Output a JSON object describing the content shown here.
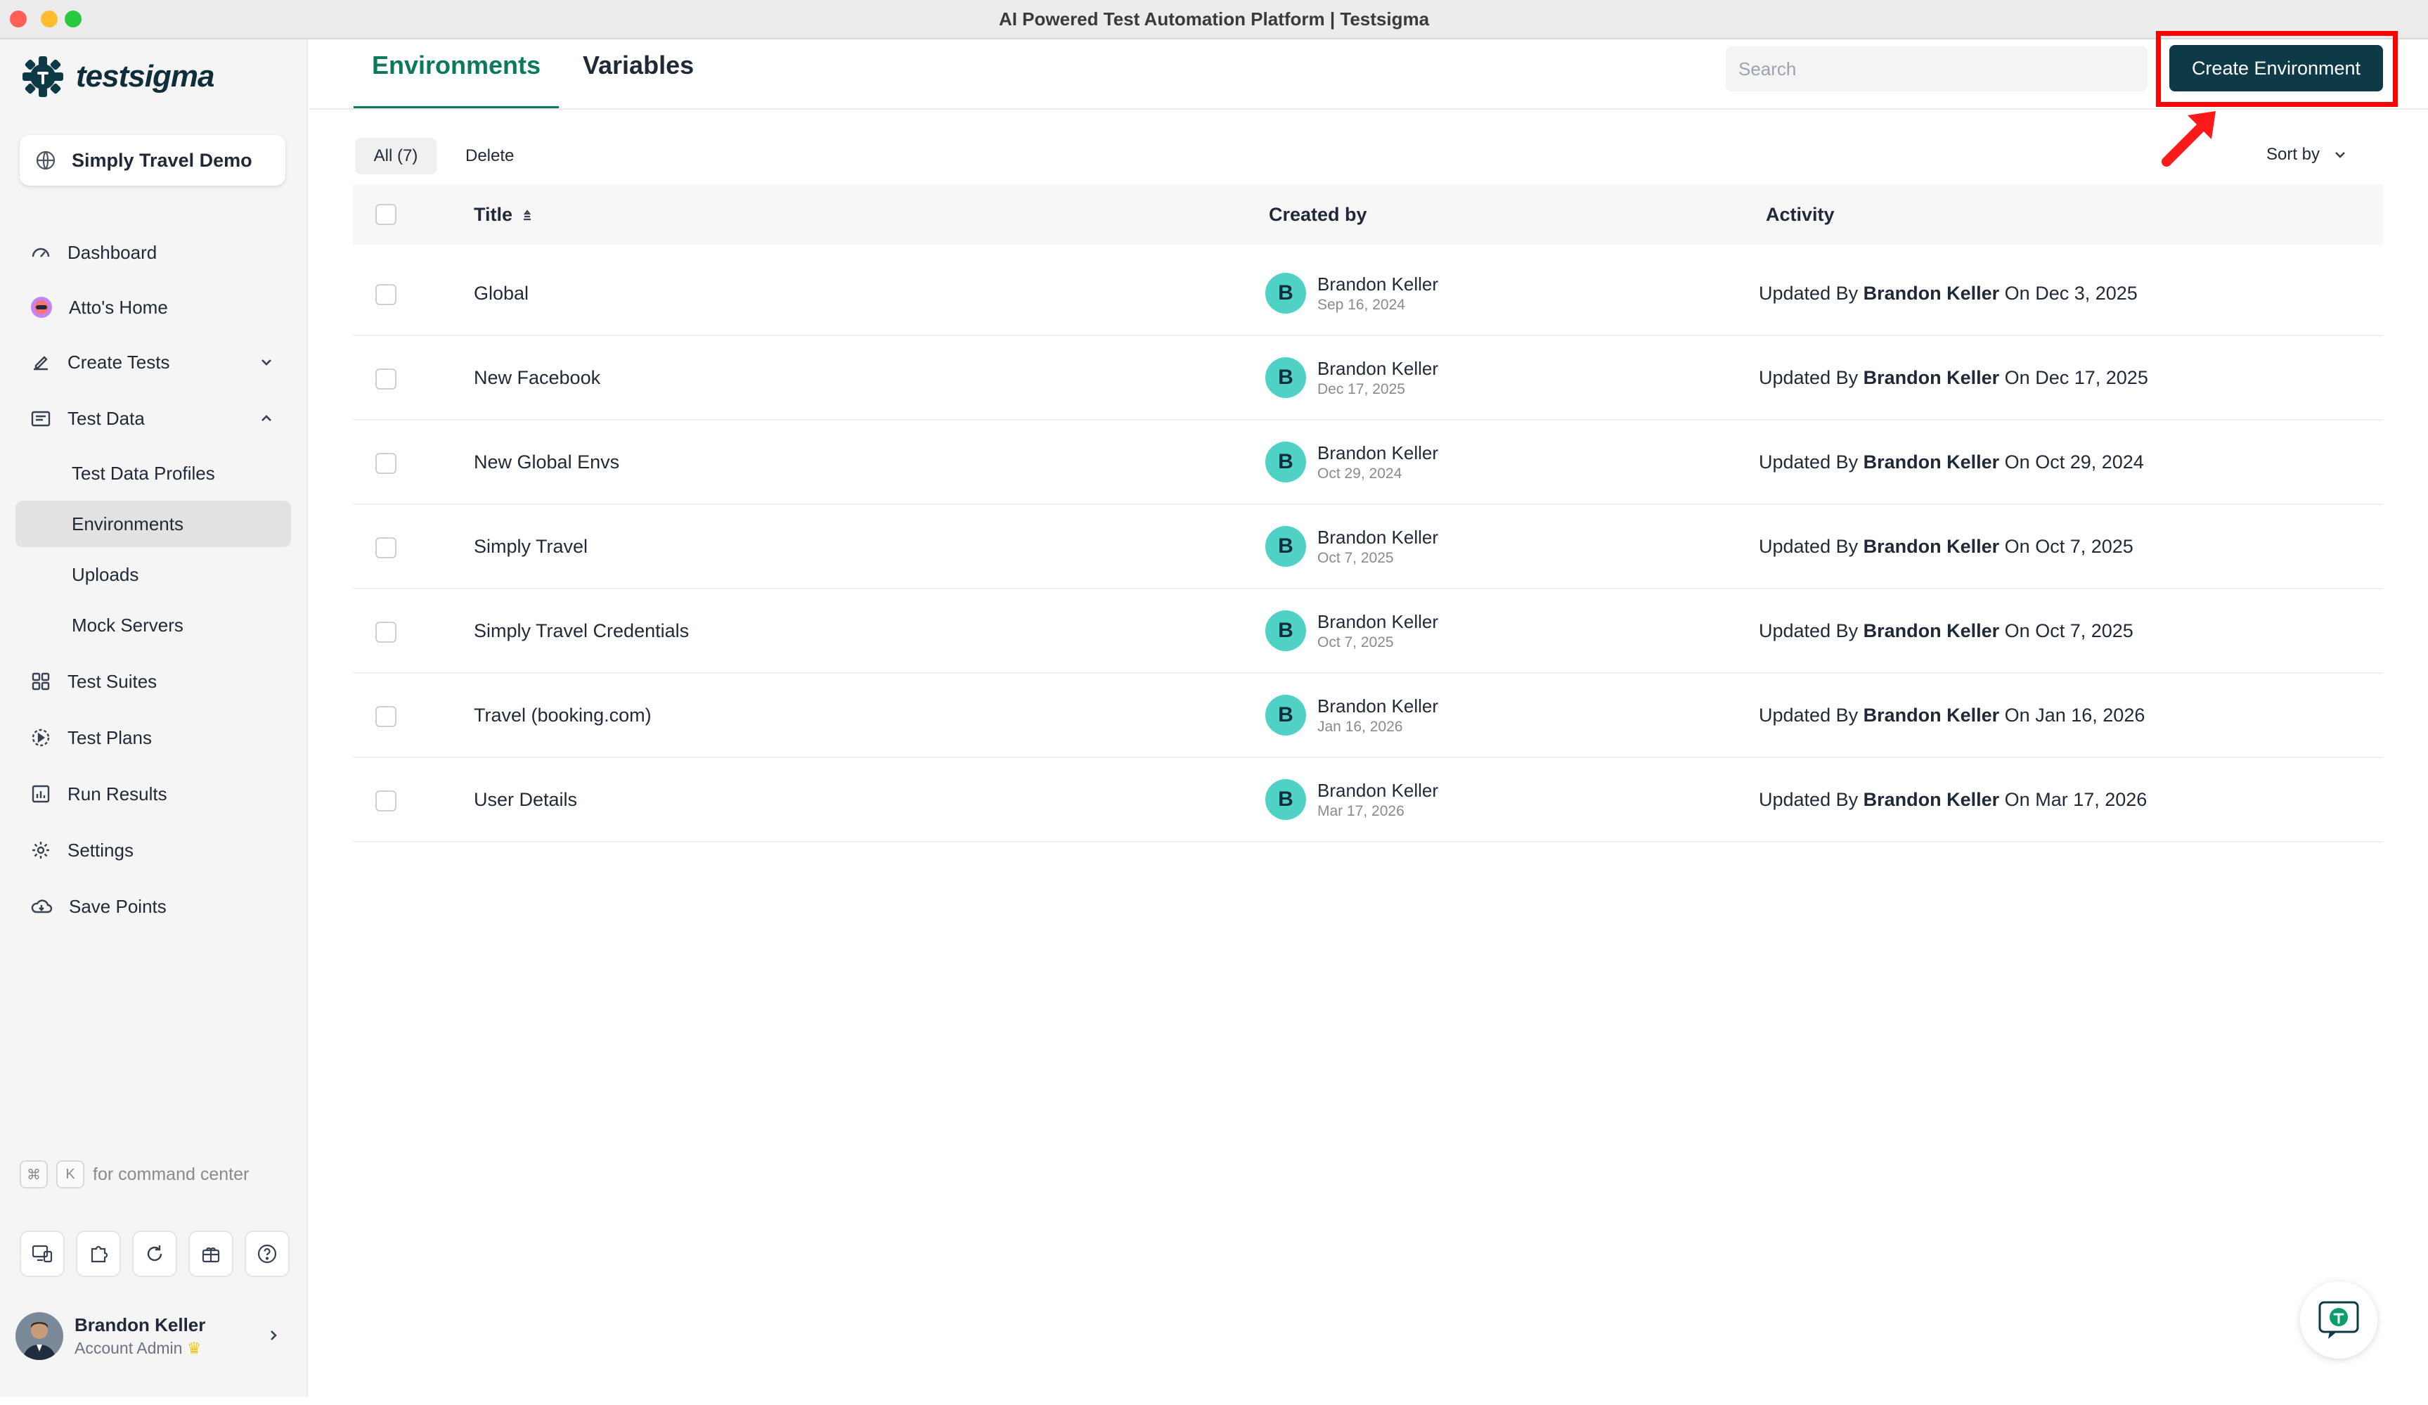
{
  "window": {
    "title": "AI Powered Test Automation Platform | Testsigma"
  },
  "brand": {
    "name": "testsigma",
    "color": "#0e3a47",
    "accent": "#0b7a5c"
  },
  "project": {
    "name": "Simply Travel Demo"
  },
  "sidebar": {
    "items": [
      {
        "label": "Dashboard",
        "icon": "gauge-icon"
      },
      {
        "label": "Atto's Home",
        "icon": "atto-avatar-icon"
      },
      {
        "label": "Create Tests",
        "icon": "pen-icon"
      },
      {
        "label": "Test Data",
        "icon": "folder-icon"
      },
      {
        "label": "Test Suites",
        "icon": "grid-icon"
      },
      {
        "label": "Test Plans",
        "icon": "play-circle-icon"
      },
      {
        "label": "Run Results",
        "icon": "bar-chart-icon"
      },
      {
        "label": "Settings",
        "icon": "gear-icon"
      },
      {
        "label": "Save Points",
        "icon": "cloud-icon"
      }
    ],
    "test_data_children": [
      "Test Data Profiles",
      "Environments",
      "Uploads",
      "Mock Servers"
    ],
    "active_child": "Environments",
    "command": {
      "key1": "⌘",
      "key2": "K",
      "text": "for command center"
    }
  },
  "user": {
    "name": "Brandon Keller",
    "role": "Account Admin"
  },
  "tabs": [
    {
      "label": "Environments",
      "active": true
    },
    {
      "label": "Variables",
      "active": false
    }
  ],
  "search": {
    "placeholder": "Search"
  },
  "actions": {
    "create": "Create Environment"
  },
  "filters": {
    "all": "All (7)",
    "delete": "Delete",
    "sort": "Sort by"
  },
  "table": {
    "headers": {
      "title": "Title",
      "created_by": "Created by",
      "activity": "Activity"
    },
    "rows": [
      {
        "title": "Global",
        "creator": "Brandon Keller",
        "initial": "B",
        "created": "Sep 16, 2024",
        "prefix": "Updated By",
        "updated_by": "Brandon Keller",
        "on": "On",
        "updated": "Dec 3, 2025"
      },
      {
        "title": "New Facebook",
        "creator": "Brandon Keller",
        "initial": "B",
        "created": "Dec 17, 2025",
        "prefix": "Updated By",
        "updated_by": "Brandon Keller",
        "on": "On",
        "updated": "Dec 17, 2025"
      },
      {
        "title": "New Global Envs",
        "creator": "Brandon Keller",
        "initial": "B",
        "created": "Oct 29, 2024",
        "prefix": "Updated By",
        "updated_by": "Brandon Keller",
        "on": "On",
        "updated": "Oct 29, 2024"
      },
      {
        "title": "Simply Travel",
        "creator": "Brandon Keller",
        "initial": "B",
        "created": "Oct 7, 2025",
        "prefix": "Updated By",
        "updated_by": "Brandon Keller",
        "on": "On",
        "updated": "Oct 7, 2025"
      },
      {
        "title": "Simply Travel Credentials",
        "creator": "Brandon Keller",
        "initial": "B",
        "created": "Oct 7, 2025",
        "prefix": "Updated By",
        "updated_by": "Brandon Keller",
        "on": "On",
        "updated": "Oct 7, 2025"
      },
      {
        "title": "Travel (booking.com)",
        "creator": "Brandon Keller",
        "initial": "B",
        "created": "Jan 16, 2026",
        "prefix": "Updated By",
        "updated_by": "Brandon Keller",
        "on": "On",
        "updated": "Jan 16, 2026"
      },
      {
        "title": "User Details",
        "creator": "Brandon Keller",
        "initial": "B",
        "created": "Mar 17, 2026",
        "prefix": "Updated By",
        "updated_by": "Brandon Keller",
        "on": "On",
        "updated": "Mar 17, 2026"
      }
    ]
  }
}
